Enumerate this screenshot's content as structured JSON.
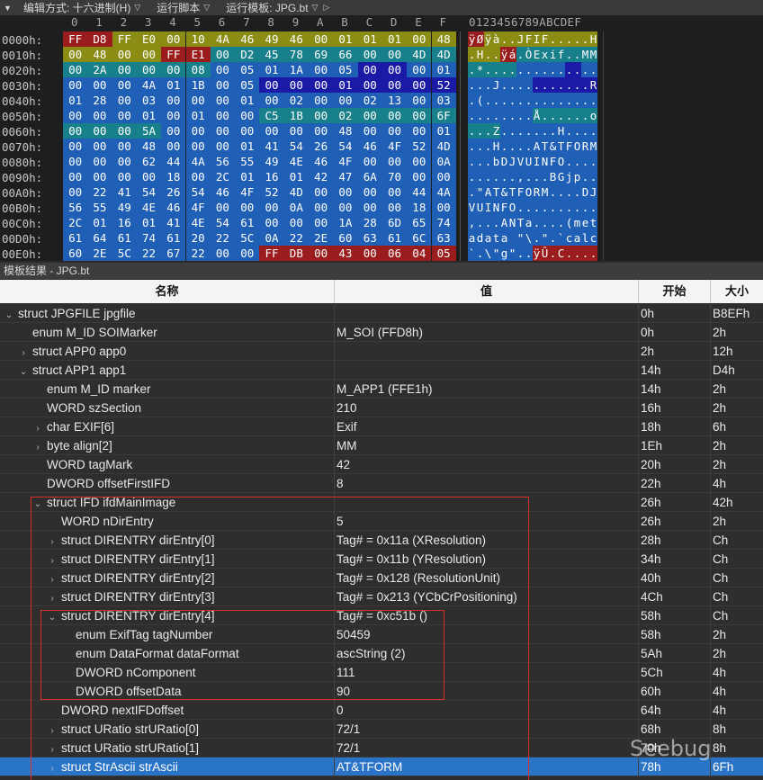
{
  "toolbar": {
    "edit_mode": "编辑方式: 十六进制(H)",
    "run_script": "运行脚本",
    "run_template": "运行模板: JPG.bt"
  },
  "hex": {
    "col_headers": [
      "0",
      "1",
      "2",
      "3",
      "4",
      "5",
      "6",
      "7",
      "8",
      "9",
      "A",
      "B",
      "C",
      "D",
      "E",
      "F"
    ],
    "ascii_header": "0123456789ABCDEF",
    "rows": [
      {
        "addr": "0000h:",
        "bytes": [
          "FF",
          "D8",
          "FF",
          "E0",
          "00",
          "10",
          "4A",
          "46",
          "49",
          "46",
          "00",
          "01",
          "01",
          "01",
          "00",
          "48"
        ],
        "ascii": "ÿØÿà..JFIF.....H"
      },
      {
        "addr": "0010h:",
        "bytes": [
          "00",
          "48",
          "00",
          "00",
          "FF",
          "E1",
          "00",
          "D2",
          "45",
          "78",
          "69",
          "66",
          "00",
          "00",
          "4D",
          "4D"
        ],
        "ascii": ".H..ÿá.ÒExif..MM"
      },
      {
        "addr": "0020h:",
        "bytes": [
          "00",
          "2A",
          "00",
          "00",
          "00",
          "08",
          "00",
          "05",
          "01",
          "1A",
          "00",
          "05",
          "00",
          "00",
          "00",
          "01"
        ],
        "ascii": ".*.............."
      },
      {
        "addr": "0030h:",
        "bytes": [
          "00",
          "00",
          "00",
          "4A",
          "01",
          "1B",
          "00",
          "05",
          "00",
          "00",
          "00",
          "01",
          "00",
          "00",
          "00",
          "52"
        ],
        "ascii": "...J...........R"
      },
      {
        "addr": "0040h:",
        "bytes": [
          "01",
          "28",
          "00",
          "03",
          "00",
          "00",
          "00",
          "01",
          "00",
          "02",
          "00",
          "00",
          "02",
          "13",
          "00",
          "03"
        ],
        "ascii": ".(.............."
      },
      {
        "addr": "0050h:",
        "bytes": [
          "00",
          "00",
          "00",
          "01",
          "00",
          "01",
          "00",
          "00",
          "C5",
          "1B",
          "00",
          "02",
          "00",
          "00",
          "00",
          "6F"
        ],
        "ascii": "........Å......o"
      },
      {
        "addr": "0060h:",
        "bytes": [
          "00",
          "00",
          "00",
          "5A",
          "00",
          "00",
          "00",
          "00",
          "00",
          "00",
          "00",
          "48",
          "00",
          "00",
          "00",
          "01"
        ],
        "ascii": "...Z.......H...."
      },
      {
        "addr": "0070h:",
        "bytes": [
          "00",
          "00",
          "00",
          "48",
          "00",
          "00",
          "00",
          "01",
          "41",
          "54",
          "26",
          "54",
          "46",
          "4F",
          "52",
          "4D"
        ],
        "ascii": "...H....AT&TFORM"
      },
      {
        "addr": "0080h:",
        "bytes": [
          "00",
          "00",
          "00",
          "62",
          "44",
          "4A",
          "56",
          "55",
          "49",
          "4E",
          "46",
          "4F",
          "00",
          "00",
          "00",
          "0A"
        ],
        "ascii": "...bDJVUINFO...."
      },
      {
        "addr": "0090h:",
        "bytes": [
          "00",
          "00",
          "00",
          "00",
          "18",
          "00",
          "2C",
          "01",
          "16",
          "01",
          "42",
          "47",
          "6A",
          "70",
          "00",
          "00"
        ],
        "ascii": "......,...BGjp.."
      },
      {
        "addr": "00A0h:",
        "bytes": [
          "00",
          "22",
          "41",
          "54",
          "26",
          "54",
          "46",
          "4F",
          "52",
          "4D",
          "00",
          "00",
          "00",
          "00",
          "44",
          "4A"
        ],
        "ascii": ".\"AT&TFORM....DJ"
      },
      {
        "addr": "00B0h:",
        "bytes": [
          "56",
          "55",
          "49",
          "4E",
          "46",
          "4F",
          "00",
          "00",
          "00",
          "0A",
          "00",
          "00",
          "00",
          "00",
          "18",
          "00"
        ],
        "ascii": "VUINFO.........."
      },
      {
        "addr": "00C0h:",
        "bytes": [
          "2C",
          "01",
          "16",
          "01",
          "41",
          "4E",
          "54",
          "61",
          "00",
          "00",
          "00",
          "1A",
          "28",
          "6D",
          "65",
          "74"
        ],
        "ascii": ",...ANTa....(met"
      },
      {
        "addr": "00D0h:",
        "bytes": [
          "61",
          "64",
          "61",
          "74",
          "61",
          "20",
          "22",
          "5C",
          "0A",
          "22",
          "2E",
          "60",
          "63",
          "61",
          "6C",
          "63"
        ],
        "ascii": "adata \"\\.\".`calc"
      },
      {
        "addr": "00E0h:",
        "bytes": [
          "60",
          "2E",
          "5C",
          "22",
          "67",
          "22",
          "00",
          "00",
          "FF",
          "DB",
          "00",
          "43",
          "00",
          "06",
          "04",
          "05"
        ],
        "ascii": "`.\\\"g\"..ÿÛ.C...."
      }
    ],
    "colors": {
      "red": "#9b1c1c",
      "olive": "#8a8c14",
      "teal": "#17808a",
      "blue": "#1f5fb5",
      "navy": "#1a1aa6",
      "cyan_ascii": "#1e6e96"
    }
  },
  "template_bar": "模板结果 - JPG.bt",
  "table": {
    "headers": {
      "name": "名称",
      "value": "值",
      "start": "开始",
      "size": "大小"
    },
    "rows": [
      {
        "indent": 0,
        "tw": "v",
        "name": "struct JPGFILE jpgfile",
        "value": "",
        "start": "0h",
        "size": "B8EFh"
      },
      {
        "indent": 1,
        "tw": "",
        "name": "enum M_ID SOIMarker",
        "value": "M_SOI (FFD8h)",
        "start": "0h",
        "size": "2h"
      },
      {
        "indent": 1,
        "tw": ">",
        "name": "struct APP0 app0",
        "value": "",
        "start": "2h",
        "size": "12h"
      },
      {
        "indent": 1,
        "tw": "v",
        "name": "struct APP1 app1",
        "value": "",
        "start": "14h",
        "size": "D4h"
      },
      {
        "indent": 2,
        "tw": "",
        "name": "enum M_ID marker",
        "value": "M_APP1 (FFE1h)",
        "start": "14h",
        "size": "2h"
      },
      {
        "indent": 2,
        "tw": "",
        "name": "WORD szSection",
        "value": "210",
        "start": "16h",
        "size": "2h"
      },
      {
        "indent": 2,
        "tw": ">",
        "name": "char EXIF[6]",
        "value": "Exif",
        "start": "18h",
        "size": "6h"
      },
      {
        "indent": 2,
        "tw": ">",
        "name": "byte align[2]",
        "value": "MM",
        "start": "1Eh",
        "size": "2h"
      },
      {
        "indent": 2,
        "tw": "",
        "name": "WORD tagMark",
        "value": "42",
        "start": "20h",
        "size": "2h"
      },
      {
        "indent": 2,
        "tw": "",
        "name": "DWORD offsetFirstIFD",
        "value": "8",
        "start": "22h",
        "size": "4h"
      },
      {
        "indent": 2,
        "tw": "v",
        "name": "struct IFD ifdMainImage",
        "value": "",
        "start": "26h",
        "size": "42h"
      },
      {
        "indent": 3,
        "tw": "",
        "name": "WORD nDirEntry",
        "value": "5",
        "start": "26h",
        "size": "2h"
      },
      {
        "indent": 3,
        "tw": ">",
        "name": "struct DIRENTRY dirEntry[0]",
        "value": "Tag# = 0x11a (XResolution)",
        "start": "28h",
        "size": "Ch"
      },
      {
        "indent": 3,
        "tw": ">",
        "name": "struct DIRENTRY dirEntry[1]",
        "value": "Tag# = 0x11b (YResolution)",
        "start": "34h",
        "size": "Ch"
      },
      {
        "indent": 3,
        "tw": ">",
        "name": "struct DIRENTRY dirEntry[2]",
        "value": "Tag# = 0x128 (ResolutionUnit)",
        "start": "40h",
        "size": "Ch"
      },
      {
        "indent": 3,
        "tw": ">",
        "name": "struct DIRENTRY dirEntry[3]",
        "value": "Tag# = 0x213 (YCbCrPositioning)",
        "start": "4Ch",
        "size": "Ch"
      },
      {
        "indent": 3,
        "tw": "v",
        "name": "struct DIRENTRY dirEntry[4]",
        "value": "Tag# = 0xc51b ()",
        "start": "58h",
        "size": "Ch"
      },
      {
        "indent": 4,
        "tw": "",
        "name": "enum ExifTag tagNumber",
        "value": "50459",
        "start": "58h",
        "size": "2h"
      },
      {
        "indent": 4,
        "tw": "",
        "name": "enum DataFormat dataFormat",
        "value": "ascString (2)",
        "start": "5Ah",
        "size": "2h"
      },
      {
        "indent": 4,
        "tw": "",
        "name": "DWORD nComponent",
        "value": "111",
        "start": "5Ch",
        "size": "4h"
      },
      {
        "indent": 4,
        "tw": "",
        "name": "DWORD offsetData",
        "value": "90",
        "start": "60h",
        "size": "4h"
      },
      {
        "indent": 3,
        "tw": "",
        "name": "DWORD nextIFDoffset",
        "value": "0",
        "start": "64h",
        "size": "4h"
      },
      {
        "indent": 3,
        "tw": ">",
        "name": "struct URatio strURatio[0]",
        "value": "72/1",
        "start": "68h",
        "size": "8h"
      },
      {
        "indent": 3,
        "tw": ">",
        "name": "struct URatio strURatio[1]",
        "value": "72/1",
        "start": "70h",
        "size": "8h"
      },
      {
        "indent": 3,
        "tw": ">",
        "name": "struct StrAscii strAscii",
        "value": "AT&TFORM",
        "start": "78h",
        "size": "6Fh",
        "selected": true
      }
    ]
  },
  "watermark": "Seebug"
}
